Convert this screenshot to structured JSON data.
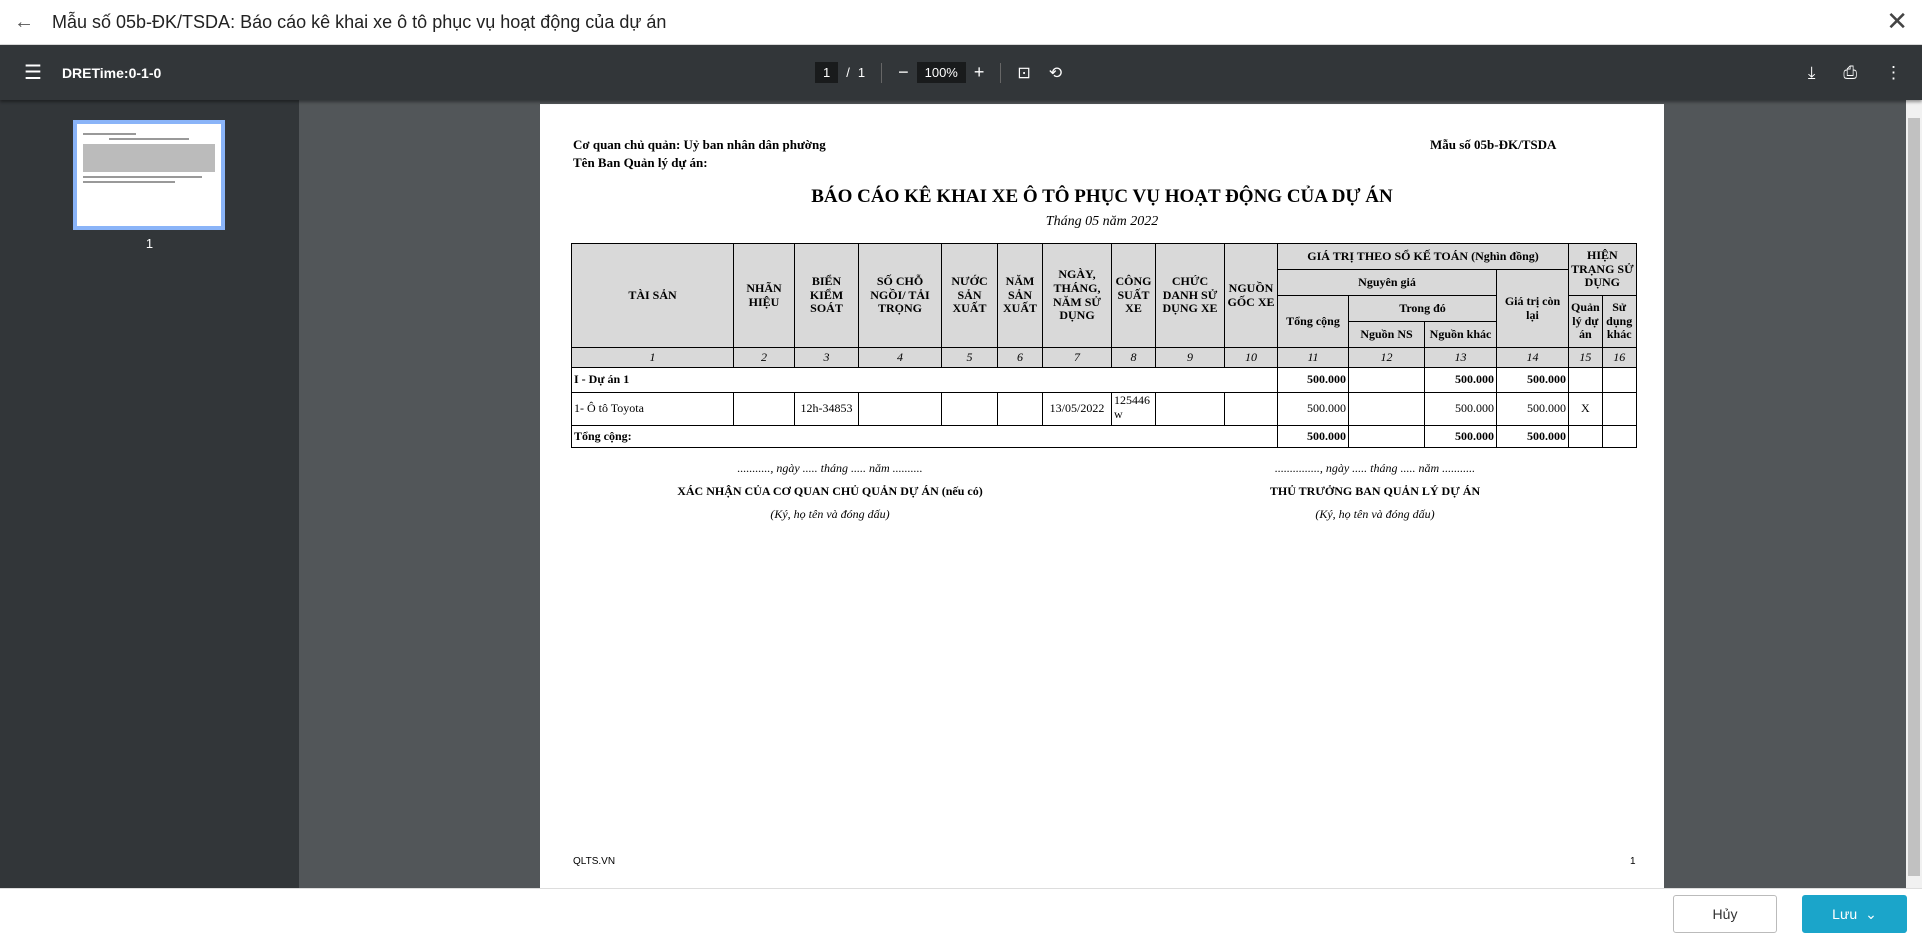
{
  "window": {
    "title": "Mẫu số 05b-ĐK/TSDA: Báo cáo kê khai xe ô tô phục vụ hoạt động của dự án"
  },
  "toolbar": {
    "doc_name": "DRETime:0-1-0",
    "page_current": "1",
    "page_sep": "/",
    "page_total": "1",
    "zoom": "100%"
  },
  "sidebar": {
    "thumb_label": "1"
  },
  "report": {
    "agency": "Cơ quan chủ quản: Uỷ ban nhân dân phường",
    "board": "Tên Ban Quản lý dự án:",
    "form_no": "Mẫu số 05b-ĐK/TSDA",
    "title": "BÁO CÁO KÊ KHAI XE Ô TÔ PHỤC VỤ HOẠT ĐỘNG CỦA DỰ ÁN",
    "month": "Tháng 05 năm 2022",
    "headers": {
      "tai_san": "TÀI SẢN",
      "nhan_hieu": "NHÃN HIỆU",
      "bien": "BIỂN KIỂM SOÁT",
      "so_cho": "SỐ CHỖ NGỒI/ TẢI TRỌNG",
      "nuoc": "NƯỚC SẢN XUẤT",
      "nam": "NĂM SẢN XUẤT",
      "ngay": "NGÀY, THÁNG, NĂM SỬ DỤNG",
      "cong_suat": "CÔNG SUẤT XE",
      "chuc_danh": "CHỨC DANH SỬ DỤNG XE",
      "nguon_goc": "NGUỒN GỐC XE",
      "gia_tri": "GIÁ TRỊ THEO SỔ KẾ TOÁN (Nghìn đồng)",
      "nguyen_gia": "Nguyên giá",
      "tong_cong": "Tổng cộng",
      "trong_do": "Trong đó",
      "nguon_ns": "Nguồn NS",
      "nguon_khac": "Nguồn khác",
      "con_lai": "Giá trị còn lại",
      "hien_trang": "HIỆN TRẠNG SỬ DỤNG",
      "quan_ly": "Quản lý dự án",
      "su_dung_khac": "Sử dụng khác"
    },
    "col_numbers": [
      "1",
      "2",
      "3",
      "4",
      "5",
      "6",
      "7",
      "8",
      "9",
      "10",
      "11",
      "12",
      "13",
      "14",
      "15",
      "16"
    ],
    "group": {
      "name": "I - Dự án 1",
      "tong": "500.000",
      "khac": "500.000",
      "con_lai": "500.000"
    },
    "row": {
      "name": "1- Ô tô Toyota",
      "bien": "12h-34853",
      "ngay": "13/05/2022",
      "cong_suat": "125446 w",
      "tong": "500.000",
      "khac": "500.000",
      "con_lai": "500.000",
      "quan_ly": "X"
    },
    "total": {
      "label": "Tổng cộng:",
      "tong": "500.000",
      "khac": "500.000",
      "con_lai": "500.000"
    },
    "sig_left": {
      "date": "..........., ngày ..... tháng ..... năm ..........",
      "title": "XÁC NHẬN CỦA CƠ QUAN CHỦ QUẢN DỰ ÁN (nếu có)",
      "note": "(Ký, họ tên và đóng dấu)"
    },
    "sig_right": {
      "date": "..............., ngày ..... tháng ..... năm ...........",
      "title": "THỦ TRƯỞNG BAN QUẢN LÝ DỰ ÁN",
      "note": "(Ký, họ tên và đóng dấu)"
    },
    "footer_left": "QLTS.VN",
    "footer_page": "1"
  },
  "buttons": {
    "cancel": "Hủy",
    "save": "Lưu"
  }
}
